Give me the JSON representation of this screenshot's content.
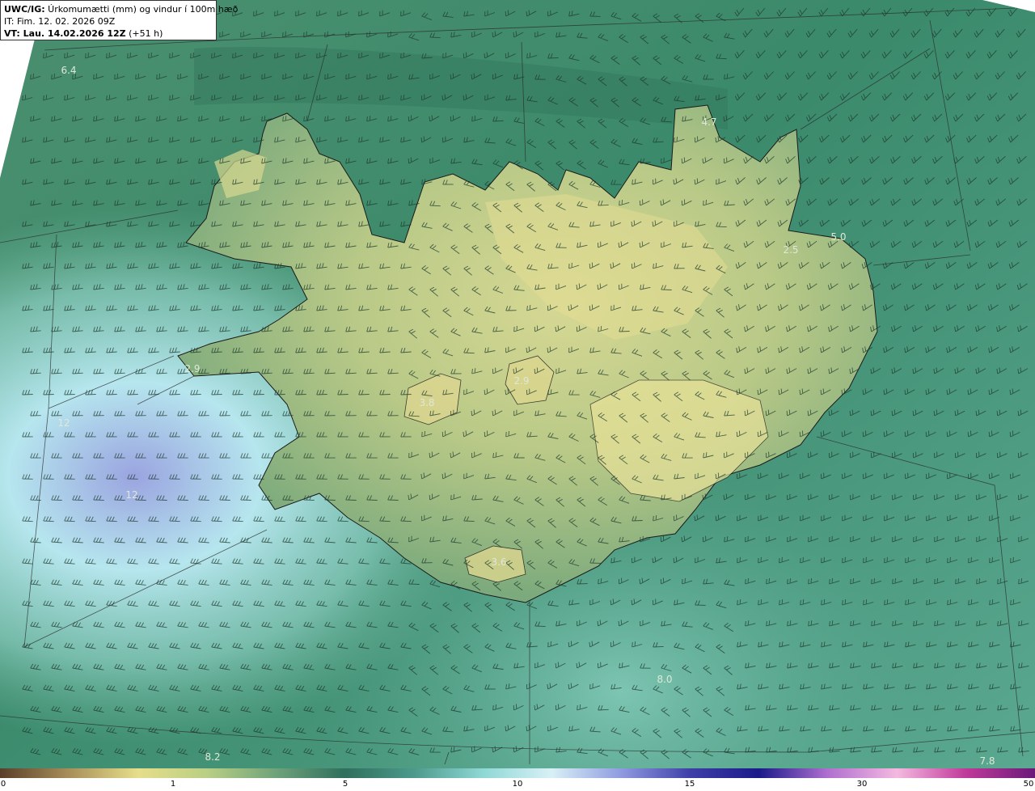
{
  "header": {
    "line1_bold": "UWC/IG:",
    "line1_rest": " Úrkomumætti (mm) og vindur í 100m hæð",
    "line2": "IT: Fim. 12. 02. 2026 09Z",
    "line3_bold": "VT: Lau. 14.02.2026 12Z",
    "line3_rest": " (+51 h)"
  },
  "map_labels": [
    {
      "id": "label-1",
      "text": "6.4"
    },
    {
      "id": "label-2",
      "text": "4.7"
    },
    {
      "id": "label-3",
      "text": "5.0"
    },
    {
      "id": "label-4",
      "text": "2.5"
    },
    {
      "id": "label-5",
      "text": "2.9"
    },
    {
      "id": "label-6",
      "text": "3.8"
    },
    {
      "id": "label-7",
      "text": "2.9"
    },
    {
      "id": "label-8",
      "text": "3.6"
    },
    {
      "id": "label-9",
      "text": "12"
    },
    {
      "id": "label-10",
      "text": "12"
    },
    {
      "id": "label-11",
      "text": "8.0"
    },
    {
      "id": "label-12",
      "text": "8.2"
    },
    {
      "id": "label-13",
      "text": "7.8"
    }
  ],
  "colorbar": {
    "ticks": [
      "0",
      "1",
      "5",
      "10",
      "15",
      "30",
      "50"
    ],
    "colors": [
      "#5a3f2a",
      "#a88f5a",
      "#e6de8a",
      "#b9cf84",
      "#6fa27a",
      "#2f6f5c",
      "#4d9a8c",
      "#8fd8d6",
      "#d8f0f6",
      "#8f9be0",
      "#3e3fa8",
      "#1a1a8a",
      "#b070d0",
      "#f4b8e0",
      "#c03a9a",
      "#6a1a7a"
    ]
  }
}
